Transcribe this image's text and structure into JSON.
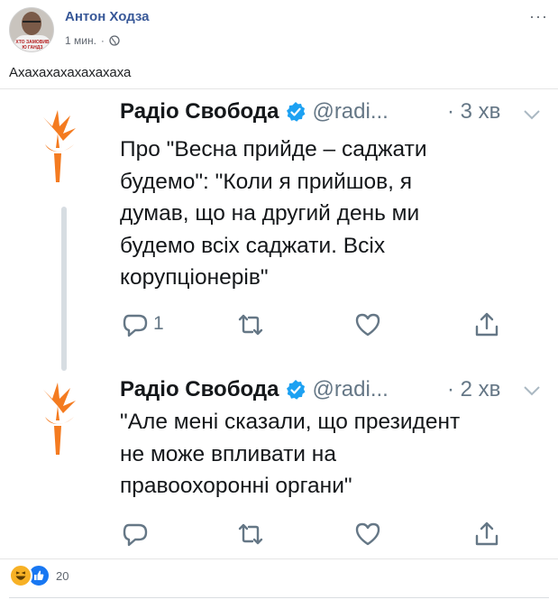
{
  "post": {
    "author": "Антон Ходза",
    "time": "1 мин.",
    "privacy_icon": "globe-icon",
    "text": "Ахахахахахахахаха",
    "avatar_caption": "ХТО ЗАМОВИВ\nЮ ГАНДЗ",
    "reactions": {
      "icons": [
        "haha-icon",
        "like-icon"
      ],
      "count": "20"
    }
  },
  "tweets": [
    {
      "name": "Радіо Свобода",
      "handle": "@radi...",
      "time": "· 3 хв",
      "lines": [
        "Про \"Весна прийде – саджати",
        "будемо\": \"Коли я прийшов, я",
        "думав, що на другий день ми",
        "будемо всіх саджати. Всіх",
        "корупціонерів\""
      ],
      "reply_count": "1"
    },
    {
      "name": "Радіо Свобода",
      "handle": "@radi...",
      "time": "· 2 хв",
      "lines": [
        "\"Але мені сказали, що президент",
        "не може впливати на",
        "правоохоронні органи\""
      ],
      "reply_count": ""
    }
  ],
  "colors": {
    "facebook_link": "#385898",
    "rfe_orange": "#f47b20",
    "twitter_blue": "#1da1f2",
    "twitter_gray": "#657786"
  }
}
